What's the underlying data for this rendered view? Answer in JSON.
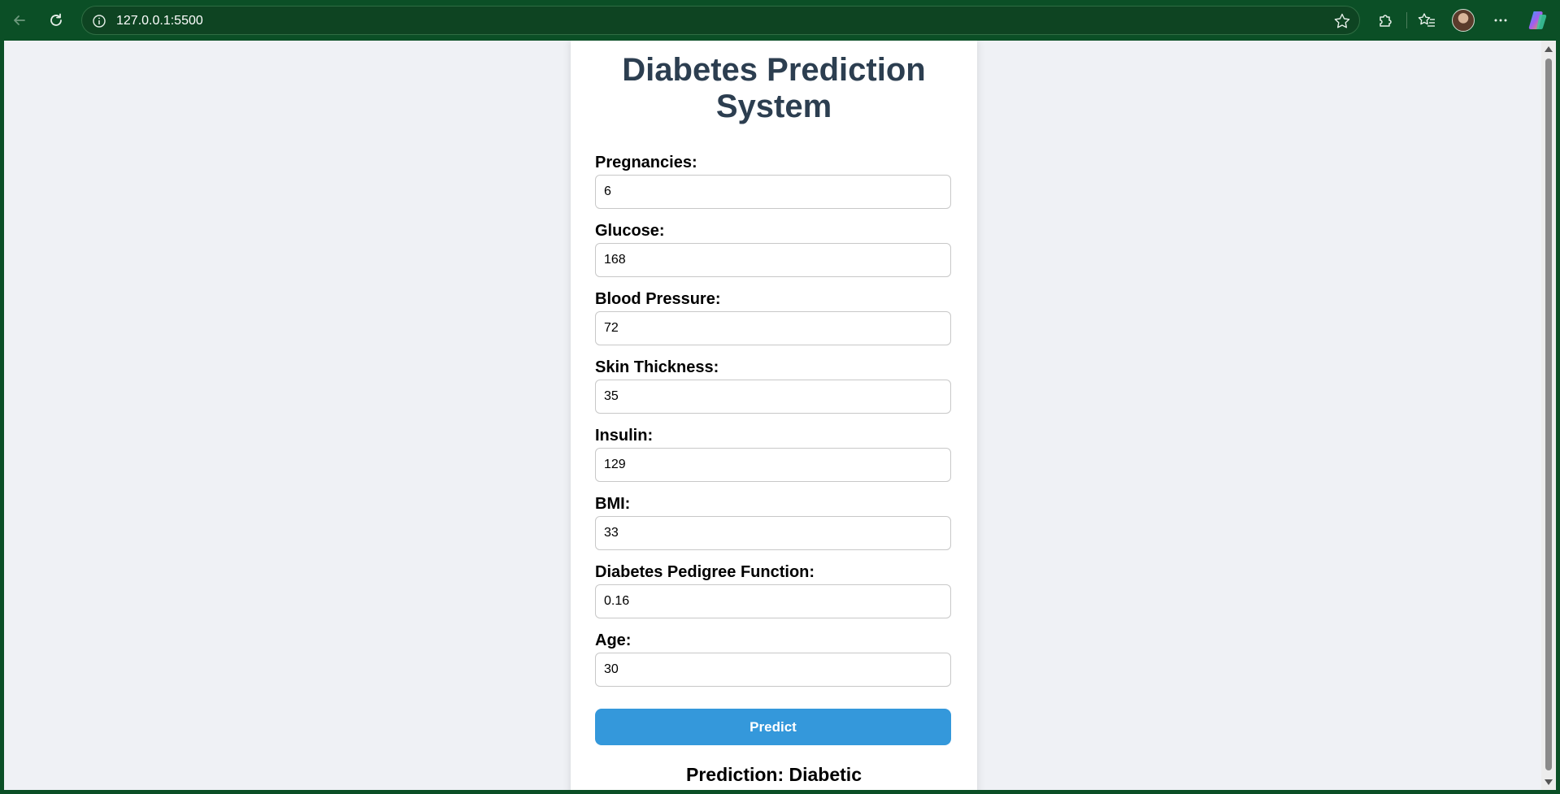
{
  "browser": {
    "url": "127.0.0.1:5500"
  },
  "page": {
    "title": "Diabetes Prediction System",
    "fields": [
      {
        "label": "Pregnancies:",
        "value": "6"
      },
      {
        "label": "Glucose:",
        "value": "168"
      },
      {
        "label": "Blood Pressure:",
        "value": "72"
      },
      {
        "label": "Skin Thickness:",
        "value": "35"
      },
      {
        "label": "Insulin:",
        "value": "129"
      },
      {
        "label": "BMI:",
        "value": "33"
      },
      {
        "label": "Diabetes Pedigree Function:",
        "value": "0.16"
      },
      {
        "label": "Age:",
        "value": "30"
      }
    ],
    "predict_label": "Predict",
    "result": "Prediction: Diabetic"
  },
  "colors": {
    "title": "#2c3e50",
    "button": "#3498db",
    "background": "#eff1f5",
    "chrome": "#0b4f26"
  }
}
